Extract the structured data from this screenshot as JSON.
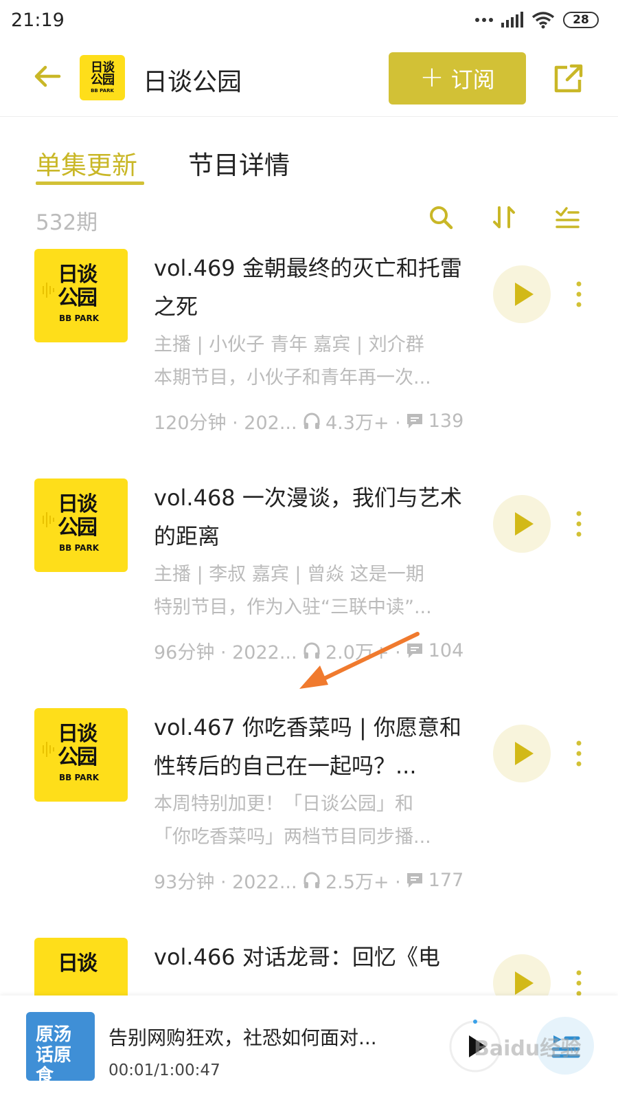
{
  "status_bar": {
    "time": "21:19",
    "battery": "28"
  },
  "header": {
    "logo_line1": "日谈",
    "logo_line2": "公园",
    "logo_sub": "BB PARK",
    "title": "日谈公园",
    "subscribe_label": "订阅"
  },
  "tabs": [
    {
      "label": "单集更新",
      "active": true
    },
    {
      "label": "节目详情",
      "active": false
    }
  ],
  "episode_count": "532期",
  "episodes": [
    {
      "title": "vol.469 金朝最终的灭亡和托雷之死",
      "desc_line1": "主播 | 小伙子 青年 嘉宾 | 刘介群",
      "desc_line2": "本期节目，小伙子和青年再一次...",
      "duration": "120分钟 · 202...",
      "plays": "4.3万+ ·",
      "comments": "139"
    },
    {
      "title": "vol.468 一次漫谈，我们与艺术的距离",
      "desc_line1": "主播 | 李叔 嘉宾 | 曾焱 这是一期",
      "desc_line2": "特别节目，作为入驻“三联中读”...",
      "duration": "96分钟 · 2022...",
      "plays": "2.0万+ ·",
      "comments": "104"
    },
    {
      "title": "vol.467 你吃香菜吗 | 你愿意和性转后的自己在一起吗？...",
      "desc_line1": "本周特别加更！「日谈公园」和",
      "desc_line2": "「你吃香菜吗」两档节目同步播...",
      "duration": "93分钟 · 2022...",
      "plays": "2.5万+ ·",
      "comments": "177"
    },
    {
      "title": "vol.466 对话龙哥：回忆《电",
      "desc_line1": "",
      "desc_line2": "",
      "duration": "",
      "plays": "",
      "comments": ""
    }
  ],
  "cover_text": {
    "line1": "日谈",
    "line2": "公园",
    "sub": "BB PARK"
  },
  "mini_player": {
    "cover_text": "原汤话原食",
    "title": "告别网购狂欢，社恐如何面对...",
    "time": "00:01/1:00:47"
  },
  "watermark": "Baidu经验",
  "colors": {
    "accent": "#d2c136",
    "cover_yellow": "#fede1a",
    "muted": "#bbbbbb",
    "arrow": "#f07a2e"
  }
}
